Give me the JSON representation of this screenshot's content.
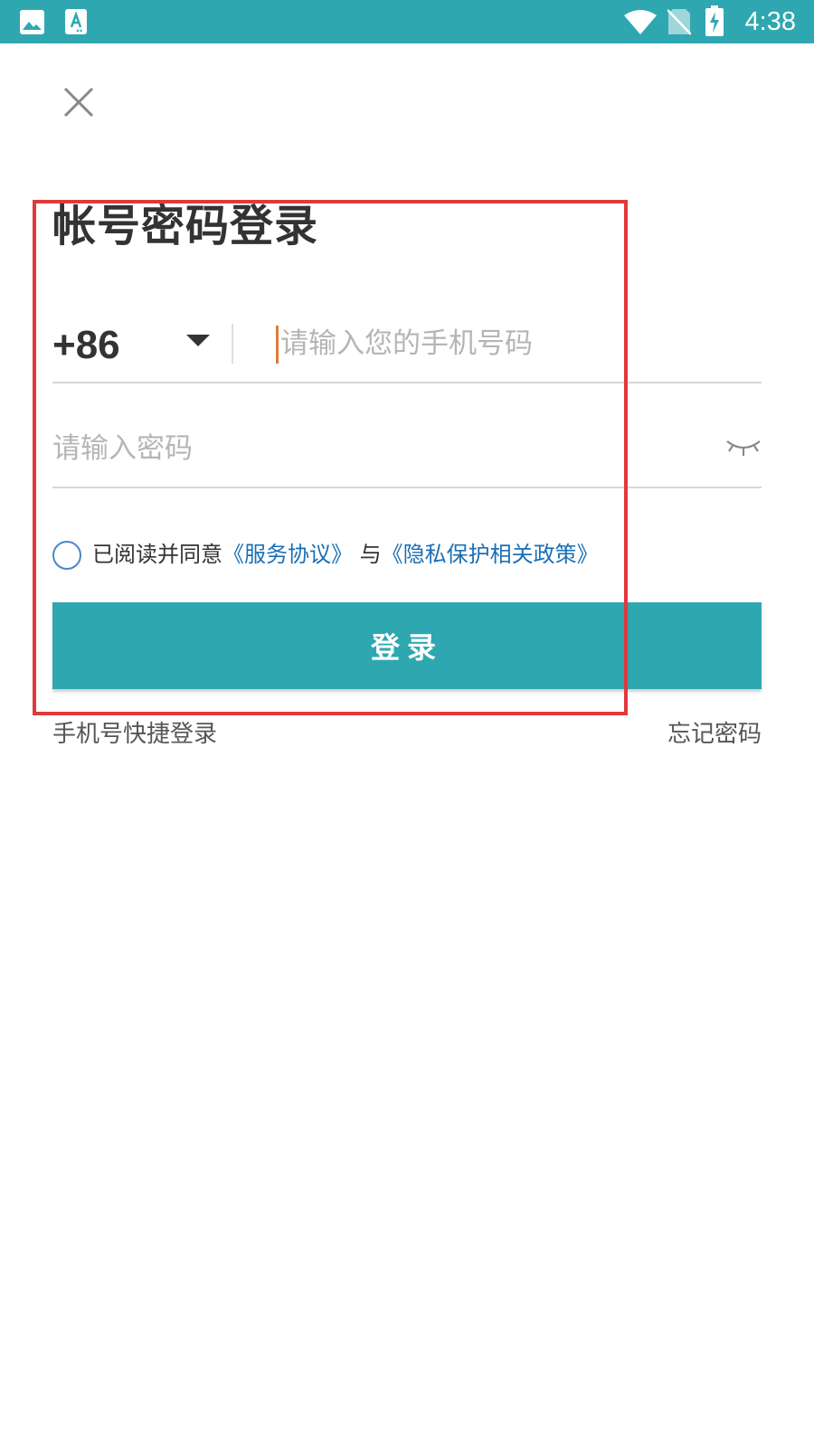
{
  "status_bar": {
    "time": "4:38",
    "icons": [
      "image-icon",
      "font-download-icon",
      "wifi-icon",
      "no-sim-icon",
      "battery-charging-icon"
    ],
    "background": "#2fa7b0"
  },
  "page": {
    "title": "帐号密码登录"
  },
  "phone": {
    "country_code": "+86",
    "placeholder": "请输入您的手机号码"
  },
  "password": {
    "placeholder": "请输入密码"
  },
  "agreement": {
    "prefix": "已阅读并同意",
    "service_link": "《服务协议》",
    "connector": " 与",
    "privacy_link": "《隐私保护相关政策》"
  },
  "login_button": {
    "label": "登录"
  },
  "footer_links": {
    "quick_login": "手机号快捷登录",
    "forgot_password": "忘记密码"
  },
  "colors": {
    "accent": "#2fa7b0",
    "link": "#1a6fb5",
    "highlight": "#e0393b",
    "caret": "#e07a3c"
  }
}
